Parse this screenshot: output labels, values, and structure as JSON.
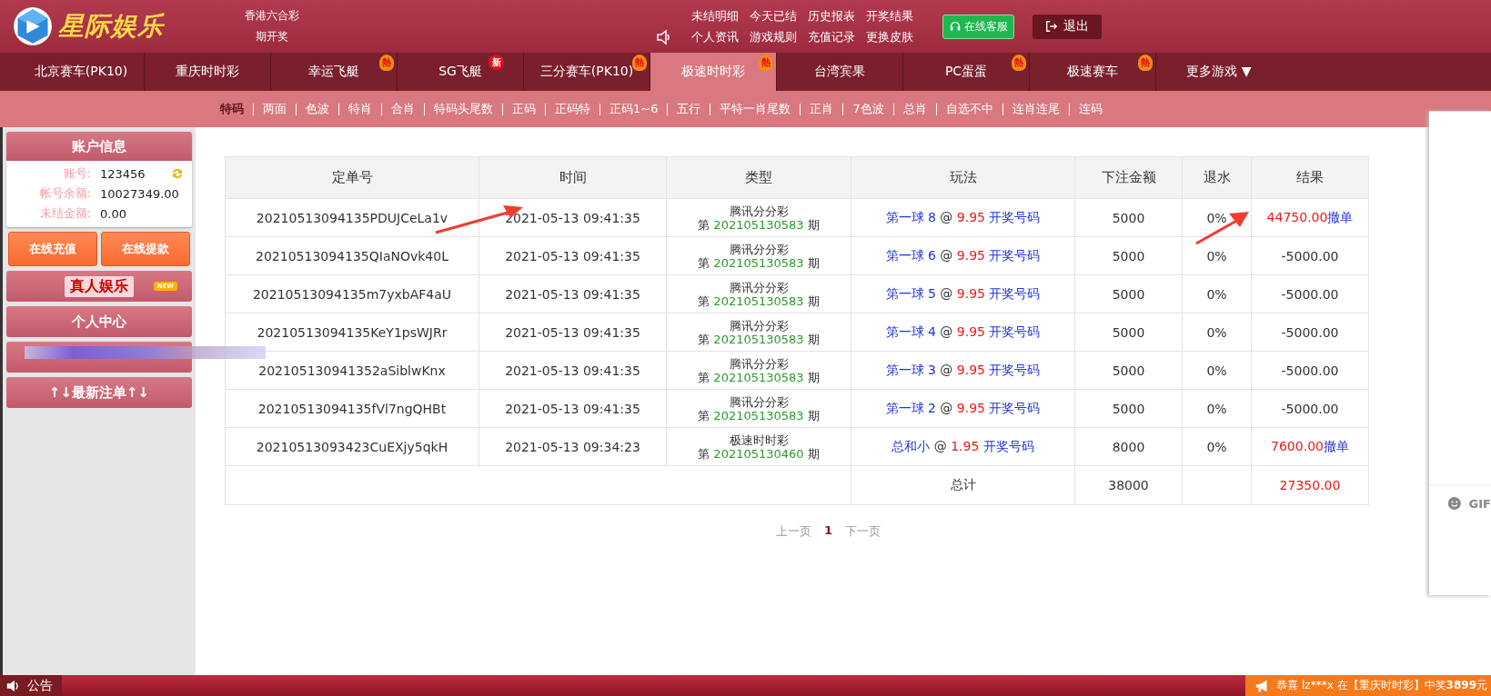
{
  "header": {
    "logo_text": "星际娱乐",
    "lottery_name": "香港六合彩",
    "draw_label": "期开奖",
    "links": [
      "未结明细",
      "今天已结",
      "历史报表",
      "开奖结果",
      "个人资讯",
      "游戏规则",
      "充值记录",
      "更换皮肤"
    ],
    "service_button": "在线客服",
    "logout_button": "退出"
  },
  "game_tabs": [
    {
      "label": "北京赛车(PK10)",
      "selected": false
    },
    {
      "label": "重庆时时彩",
      "selected": false
    },
    {
      "label": "幸运飞艇",
      "selected": false,
      "badge": {
        "kind": "hot",
        "text": "熱"
      }
    },
    {
      "label": "SG飞艇",
      "selected": false,
      "badge": {
        "kind": "new",
        "text": "新"
      }
    },
    {
      "label": "三分赛车(PK10)",
      "selected": false,
      "badge": {
        "kind": "hot",
        "text": "熱"
      }
    },
    {
      "label": "极速时时彩",
      "selected": true,
      "badge": {
        "kind": "hot",
        "text": "熱"
      }
    },
    {
      "label": "台湾宾果",
      "selected": false
    },
    {
      "label": "PC蛋蛋",
      "selected": false,
      "badge": {
        "kind": "hot",
        "text": "熱"
      }
    },
    {
      "label": "极速赛车",
      "selected": false,
      "badge": {
        "kind": "hot",
        "text": "熱"
      }
    },
    {
      "label": "更多游戏 ▼",
      "selected": false
    }
  ],
  "sub_tabs": [
    {
      "label": "特码",
      "selected": true
    },
    {
      "label": "两面",
      "selected": false
    },
    {
      "label": "色波",
      "selected": false
    },
    {
      "label": "特肖",
      "selected": false
    },
    {
      "label": "合肖",
      "selected": false
    },
    {
      "label": "特码头尾数",
      "selected": false
    },
    {
      "label": "正码",
      "selected": false
    },
    {
      "label": "正码特",
      "selected": false
    },
    {
      "label": "正码1~6",
      "selected": false
    },
    {
      "label": "五行",
      "selected": false
    },
    {
      "label": "平特一肖尾数",
      "selected": false
    },
    {
      "label": "正肖",
      "selected": false
    },
    {
      "label": "7色波",
      "selected": false
    },
    {
      "label": "总肖",
      "selected": false
    },
    {
      "label": "自选不中",
      "selected": false
    },
    {
      "label": "连肖连尾",
      "selected": false
    },
    {
      "label": "连码",
      "selected": false
    }
  ],
  "sidebar": {
    "account": {
      "title": "账户信息",
      "rows": [
        {
          "label": "账号:",
          "value": "123456"
        },
        {
          "label": "帐号余额:",
          "value": "10027349.00"
        },
        {
          "label": "未结金额:",
          "value": "0.00"
        }
      ]
    },
    "action_buttons": [
      "在线充值",
      "在线提款"
    ],
    "menu": [
      {
        "kind": "highlight",
        "label": "真人娱乐",
        "badge": "NEW"
      },
      {
        "kind": "normal",
        "label": "个人中心"
      },
      {
        "kind": "obscured"
      },
      {
        "kind": "normal",
        "label": "↑↓最新注单↑↓"
      }
    ]
  },
  "table": {
    "columns": [
      "定单号",
      "时间",
      "类型",
      "玩法",
      "下注金额",
      "退水",
      "结果"
    ],
    "rows": [
      {
        "order": "20210513094135PDUJCeLa1v",
        "time": "2021-05-13 09:41:35",
        "game": "腾讯分分彩",
        "issue_prefix": "第",
        "issue": "202105130583",
        "issue_suffix": "期",
        "play": "第一球 8",
        "at": "@",
        "odds": "9.95",
        "draw_link": "开奖号码",
        "amount": "5000",
        "rebate": "0%",
        "result": "44750.00",
        "highlight": true,
        "cancel": "撤单"
      },
      {
        "order": "20210513094135QIaNOvk40L",
        "time": "2021-05-13 09:41:35",
        "game": "腾讯分分彩",
        "issue_prefix": "第",
        "issue": "202105130583",
        "issue_suffix": "期",
        "play": "第一球 6",
        "at": "@",
        "odds": "9.95",
        "draw_link": "开奖号码",
        "amount": "5000",
        "rebate": "0%",
        "result": "-5000.00",
        "highlight": false
      },
      {
        "order": "20210513094135m7yxbAF4aU",
        "time": "2021-05-13 09:41:35",
        "game": "腾讯分分彩",
        "issue_prefix": "第",
        "issue": "202105130583",
        "issue_suffix": "期",
        "play": "第一球 5",
        "at": "@",
        "odds": "9.95",
        "draw_link": "开奖号码",
        "amount": "5000",
        "rebate": "0%",
        "result": "-5000.00",
        "highlight": false
      },
      {
        "order": "20210513094135KeY1psWJRr",
        "time": "2021-05-13 09:41:35",
        "game": "腾讯分分彩",
        "issue_prefix": "第",
        "issue": "202105130583",
        "issue_suffix": "期",
        "play": "第一球 4",
        "at": "@",
        "odds": "9.95",
        "draw_link": "开奖号码",
        "amount": "5000",
        "rebate": "0%",
        "result": "-5000.00",
        "highlight": false
      },
      {
        "order": "202105130941352aSiblwKnx",
        "time": "2021-05-13 09:41:35",
        "game": "腾讯分分彩",
        "issue_prefix": "第",
        "issue": "202105130583",
        "issue_suffix": "期",
        "play": "第一球 3",
        "at": "@",
        "odds": "9.95",
        "draw_link": "开奖号码",
        "amount": "5000",
        "rebate": "0%",
        "result": "-5000.00",
        "highlight": false
      },
      {
        "order": "20210513094135fVl7ngQHBt",
        "time": "2021-05-13 09:41:35",
        "game": "腾讯分分彩",
        "issue_prefix": "第",
        "issue": "202105130583",
        "issue_suffix": "期",
        "play": "第一球 2",
        "at": "@",
        "odds": "9.95",
        "draw_link": "开奖号码",
        "amount": "5000",
        "rebate": "0%",
        "result": "-5000.00",
        "highlight": false
      },
      {
        "order": "20210513093423CuEXjy5qkH",
        "time": "2021-05-13 09:34:23",
        "game": "极速时时彩",
        "issue_prefix": "第",
        "issue": "202105130460",
        "issue_suffix": "期",
        "play": "总和小",
        "at": "@",
        "odds": "1.95",
        "draw_link": "开奖号码",
        "amount": "8000",
        "rebate": "0%",
        "result": "7600.00",
        "highlight": true,
        "cancel": "撤单"
      }
    ],
    "total": {
      "label": "总计",
      "amount": "38000",
      "result": "27350.00"
    }
  },
  "annotations": [
    {
      "kind": "arrow"
    },
    {
      "kind": "arrow"
    }
  ],
  "pagination": [
    {
      "label": "上一页",
      "selected": false
    },
    {
      "label": "1",
      "selected": true
    },
    {
      "label": "下一页",
      "selected": false
    }
  ],
  "chat_panel": {
    "gif_button": "GIF"
  },
  "footer": {
    "notice_label": "公告",
    "winner_text": "恭喜 lz***x 在【重庆时时彩】中奖",
    "winner_amount": "3899",
    "winner_unit": "元"
  }
}
